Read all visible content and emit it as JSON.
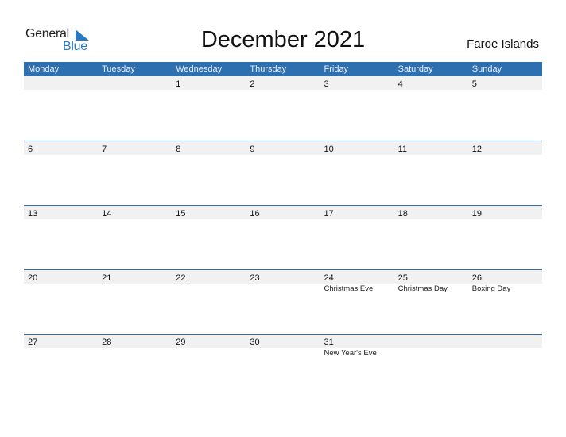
{
  "logo": {
    "part1": "General",
    "part2": "Blue",
    "icon": "triangle-flag-icon",
    "accent": "#2a79c2"
  },
  "title": "December 2021",
  "country": "Faroe Islands",
  "colors": {
    "header_bg": "#2e6fb0",
    "band_bg": "#f1f1f1"
  },
  "weekdays": [
    "Monday",
    "Tuesday",
    "Wednesday",
    "Thursday",
    "Friday",
    "Saturday",
    "Sunday"
  ],
  "weeks": [
    {
      "days": [
        {
          "num": "",
          "holiday": ""
        },
        {
          "num": "",
          "holiday": ""
        },
        {
          "num": "1",
          "holiday": ""
        },
        {
          "num": "2",
          "holiday": ""
        },
        {
          "num": "3",
          "holiday": ""
        },
        {
          "num": "4",
          "holiday": ""
        },
        {
          "num": "5",
          "holiday": ""
        }
      ]
    },
    {
      "days": [
        {
          "num": "6",
          "holiday": ""
        },
        {
          "num": "7",
          "holiday": ""
        },
        {
          "num": "8",
          "holiday": ""
        },
        {
          "num": "9",
          "holiday": ""
        },
        {
          "num": "10",
          "holiday": ""
        },
        {
          "num": "11",
          "holiday": ""
        },
        {
          "num": "12",
          "holiday": ""
        }
      ]
    },
    {
      "days": [
        {
          "num": "13",
          "holiday": ""
        },
        {
          "num": "14",
          "holiday": ""
        },
        {
          "num": "15",
          "holiday": ""
        },
        {
          "num": "16",
          "holiday": ""
        },
        {
          "num": "17",
          "holiday": ""
        },
        {
          "num": "18",
          "holiday": ""
        },
        {
          "num": "19",
          "holiday": ""
        }
      ]
    },
    {
      "days": [
        {
          "num": "20",
          "holiday": ""
        },
        {
          "num": "21",
          "holiday": ""
        },
        {
          "num": "22",
          "holiday": ""
        },
        {
          "num": "23",
          "holiday": ""
        },
        {
          "num": "24",
          "holiday": "Christmas Eve"
        },
        {
          "num": "25",
          "holiday": "Christmas Day"
        },
        {
          "num": "26",
          "holiday": "Boxing Day"
        }
      ]
    },
    {
      "days": [
        {
          "num": "27",
          "holiday": ""
        },
        {
          "num": "28",
          "holiday": ""
        },
        {
          "num": "29",
          "holiday": ""
        },
        {
          "num": "30",
          "holiday": ""
        },
        {
          "num": "31",
          "holiday": "New Year's Eve"
        },
        {
          "num": "",
          "holiday": ""
        },
        {
          "num": "",
          "holiday": ""
        }
      ]
    }
  ]
}
